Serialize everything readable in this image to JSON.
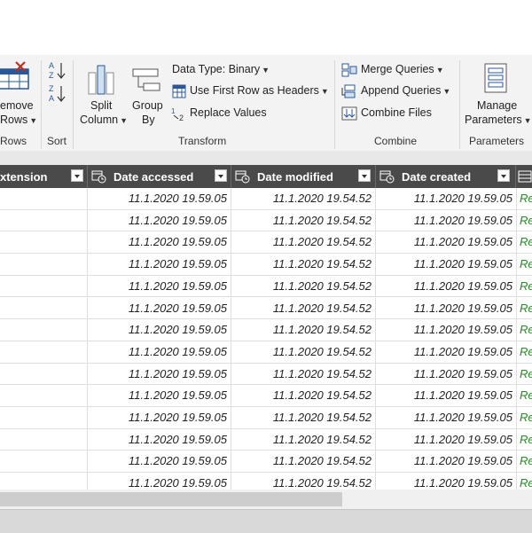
{
  "ribbon": {
    "remove_rows": {
      "line1": "emove",
      "line2": "Rows"
    },
    "groups": {
      "rows": "Rows",
      "sort": "Sort",
      "transform": "Transform",
      "combine": "Combine",
      "parameters": "Parameters"
    },
    "split_column": {
      "line1": "Split",
      "line2": "Column"
    },
    "group_by": {
      "line1": "Group",
      "line2": "By"
    },
    "data_type": "Data Type: Binary",
    "use_first_row": "Use First Row as Headers",
    "replace_values": "Replace Values",
    "merge_queries": "Merge Queries",
    "append_queries": "Append Queries",
    "combine_files": "Combine Files",
    "manage_parameters": {
      "line1": "Manage",
      "line2": "Parameters"
    }
  },
  "table": {
    "headers": {
      "extension": "xtension",
      "date_accessed": "Date accessed",
      "date_modified": "Date modified",
      "date_created": "Date created"
    },
    "rows": [
      {
        "accessed": "11.1.2020 19.59.05",
        "modified": "11.1.2020 19.54.52",
        "created": "11.1.2020 19.59.05",
        "link": "Re"
      },
      {
        "accessed": "11.1.2020 19.59.05",
        "modified": "11.1.2020 19.54.52",
        "created": "11.1.2020 19.59.05",
        "link": "Re"
      },
      {
        "accessed": "11.1.2020 19.59.05",
        "modified": "11.1.2020 19.54.52",
        "created": "11.1.2020 19.59.05",
        "link": "Re"
      },
      {
        "accessed": "11.1.2020 19.59.05",
        "modified": "11.1.2020 19.54.52",
        "created": "11.1.2020 19.59.05",
        "link": "Re"
      },
      {
        "accessed": "11.1.2020 19.59.05",
        "modified": "11.1.2020 19.54.52",
        "created": "11.1.2020 19.59.05",
        "link": "Re"
      },
      {
        "accessed": "11.1.2020 19.59.05",
        "modified": "11.1.2020 19.54.52",
        "created": "11.1.2020 19.59.05",
        "link": "Re"
      },
      {
        "accessed": "11.1.2020 19.59.05",
        "modified": "11.1.2020 19.54.52",
        "created": "11.1.2020 19.59.05",
        "link": "Re"
      },
      {
        "accessed": "11.1.2020 19.59.05",
        "modified": "11.1.2020 19.54.52",
        "created": "11.1.2020 19.59.05",
        "link": "Re"
      },
      {
        "accessed": "11.1.2020 19.59.05",
        "modified": "11.1.2020 19.54.52",
        "created": "11.1.2020 19.59.05",
        "link": "Re"
      },
      {
        "accessed": "11.1.2020 19.59.05",
        "modified": "11.1.2020 19.54.52",
        "created": "11.1.2020 19.59.05",
        "link": "Re"
      },
      {
        "accessed": "11.1.2020 19.59.05",
        "modified": "11.1.2020 19.54.52",
        "created": "11.1.2020 19.59.05",
        "link": "Re"
      },
      {
        "accessed": "11.1.2020 19.59.05",
        "modified": "11.1.2020 19.54.52",
        "created": "11.1.2020 19.59.05",
        "link": "Re"
      },
      {
        "accessed": "11.1.2020 19.59.05",
        "modified": "11.1.2020 19.54.52",
        "created": "11.1.2020 19.59.05",
        "link": "Re"
      },
      {
        "accessed": "11.1.2020 19.59.05",
        "modified": "11.1.2020 19.54.52",
        "created": "11.1.2020 19.59.05",
        "link": "Re"
      }
    ]
  },
  "colors": {
    "header_bg": "#4a4a4a",
    "link_green": "#2a8a2a",
    "ribbon_bg": "#f3f3f3"
  }
}
